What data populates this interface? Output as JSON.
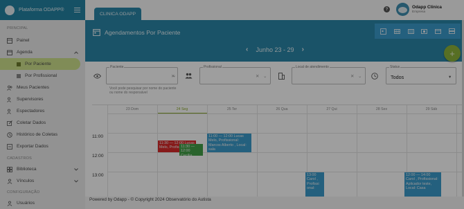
{
  "app": {
    "title": "Plataforma ODAPP®"
  },
  "sidebar": {
    "sections": {
      "principal": "PRINCIPAL",
      "cadastros": "CADASTROS",
      "configuracao": "CONFIGURAÇÃO"
    },
    "painel": "Painel",
    "agenda": "Agenda",
    "agenda_sub": {
      "por_paciente": "Por Paciente",
      "por_profissional": "Por Profissional"
    },
    "meus_pacientes": "Meus Pacientes",
    "supervisores": "Supervisores",
    "espectadores": "Espectadores",
    "coletar_dados": "Coletar Dados",
    "historico": "Histórico de Coletas",
    "exportar": "Exportar Dados",
    "biblioteca": "Biblioteca",
    "vinculos": "Vínculos",
    "usuarios": "Usuários"
  },
  "topbar": {
    "tab": "CLINICA ODAPP",
    "user_name": "Odapp Clínica",
    "user_role": "Empresa",
    "help": "?"
  },
  "page": {
    "title": "Agendamentos Por Paciente",
    "range": "Junho 23 - 29",
    "add": "+"
  },
  "filters": {
    "paciente_label": "Paciente",
    "paciente_hint": "Você pode pesquisar por nome do paciente ou nome do responsável",
    "profissional_label": "Profissional",
    "local_label": "Local de atendimento",
    "status_label": "Status",
    "status_value": "Todos"
  },
  "calendar": {
    "days": [
      "23 Dom",
      "24 Seg",
      "25 Ter",
      "26 Qua",
      "27 Qui",
      "28 Sex",
      "29 Sáb"
    ],
    "times": [
      "11:00",
      "12:00",
      "13:00"
    ],
    "events": [
      {
        "text": "11:00 — 12:00 Lucas Melo, Profissional: Marcos Alberto , Local: sala",
        "color": "#3a9bcc"
      },
      {
        "text": "11:30 — 12:00 Lucas Melo, Profissional",
        "color": "#d92b2b"
      },
      {
        "text": "11:30 — 12:00 Cecília",
        "color": "#43a047"
      },
      {
        "text": "13:00 Carol , Profissi onal:",
        "color": "#3a9bcc"
      },
      {
        "text": "12:00 — 14:00 Carol , Profissional: Aplicador teste, Local: Casa",
        "color": "#3a9bcc"
      }
    ]
  },
  "footer": {
    "text": "Powered by Odapp - © Copyright 2024 Observatório do Autista"
  },
  "colors": {
    "primary": "#2b87a9",
    "accent": "#8db33b",
    "active": "#cfe38d",
    "event_blue": "#3a9bcc",
    "event_red": "#d92b2b",
    "event_green": "#43a047"
  }
}
